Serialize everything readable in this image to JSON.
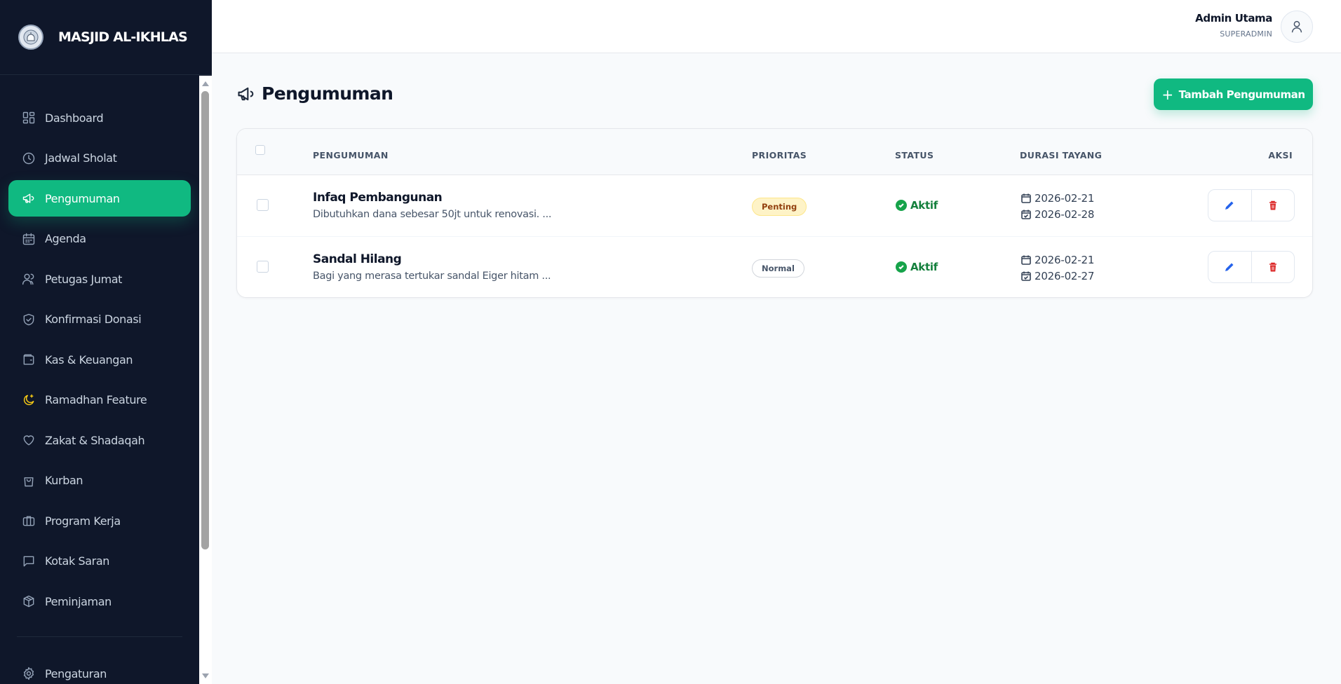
{
  "brand": {
    "name": "MASJID AL-IKHLAS"
  },
  "sidebar": {
    "items": [
      {
        "label": "Dashboard",
        "icon": "dashboard-icon"
      },
      {
        "label": "Jadwal Sholat",
        "icon": "clock-icon"
      },
      {
        "label": "Pengumuman",
        "icon": "megaphone-icon",
        "active": true
      },
      {
        "label": "Agenda",
        "icon": "calendar-icon"
      },
      {
        "label": "Petugas Jumat",
        "icon": "users-icon"
      },
      {
        "label": "Konfirmasi Donasi",
        "icon": "shield-check-icon"
      },
      {
        "label": "Kas & Keuangan",
        "icon": "wallet-icon"
      },
      {
        "label": "Ramadhan Feature",
        "icon": "moon-star-icon"
      },
      {
        "label": "Zakat & Shadaqah",
        "icon": "heart-icon"
      },
      {
        "label": "Kurban",
        "icon": "shopping-bag-icon"
      },
      {
        "label": "Program Kerja",
        "icon": "briefcase-icon"
      },
      {
        "label": "Kotak Saran",
        "icon": "message-square-icon"
      },
      {
        "label": "Peminjaman",
        "icon": "package-icon"
      }
    ],
    "settings": {
      "label": "Pengaturan",
      "icon": "gear-icon"
    }
  },
  "header": {
    "user_name": "Admin Utama",
    "user_role": "SUPERADMIN"
  },
  "page": {
    "title": "Pengumuman",
    "add_button": "Tambah Pengumuman",
    "add_icon": "+"
  },
  "table": {
    "columns": {
      "title": "PENGUMUMAN",
      "priority": "PRIORITAS",
      "status": "STATUS",
      "duration": "DURASI TAYANG",
      "actions": "AKSI"
    },
    "rows": [
      {
        "title": "Infaq Pembangunan",
        "description": "Dibutuhkan dana sebesar 50jt untuk renovasi. ...",
        "priority": "Penting",
        "status": "Aktif",
        "start_date": "2026-02-21",
        "end_date": "2026-02-28"
      },
      {
        "title": "Sandal Hilang",
        "description": "Bagi yang merasa tertukar sandal Eiger hitam ...",
        "priority": "Normal",
        "status": "Aktif",
        "start_date": "2026-02-21",
        "end_date": "2026-02-27"
      }
    ]
  },
  "colors": {
    "sidebar_bg": "#0f172a",
    "accent": "#10b981",
    "status_active": "#15803d",
    "edit_icon": "#2563eb",
    "delete_icon": "#dc2626",
    "priority_important_bg": "#fef3c7"
  }
}
